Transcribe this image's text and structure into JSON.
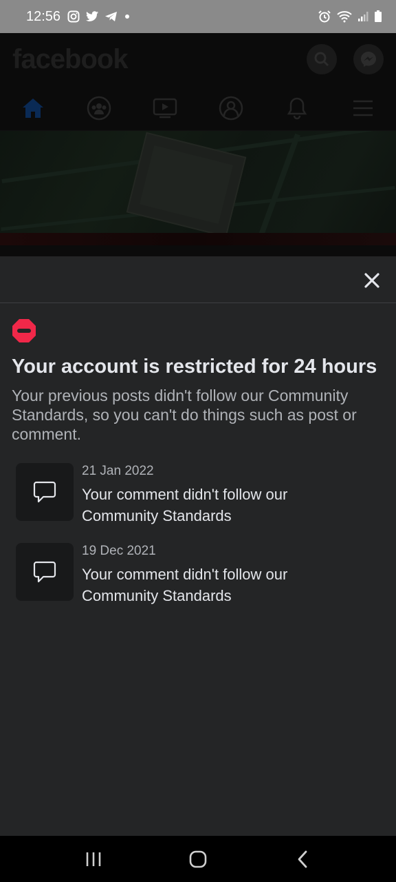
{
  "status_bar": {
    "time": "12:56",
    "left_icons": [
      "instagram-icon",
      "twitter-icon",
      "telegram-icon",
      "dot-icon"
    ],
    "right_icons": [
      "alarm-icon",
      "wifi-icon",
      "signal-icon",
      "battery-icon"
    ]
  },
  "background": {
    "logo": "facebook",
    "header_icons": [
      "search-icon",
      "messenger-icon"
    ],
    "nav_icons": [
      "home-icon",
      "groups-icon",
      "watch-icon",
      "profile-icon",
      "bell-icon",
      "menu-icon"
    ]
  },
  "sheet": {
    "close_icon": "close-icon",
    "warning_icon": "restricted-icon",
    "title": "Your account is restricted for 24 hours",
    "subtitle": "Your previous posts didn't follow our Community Standards, so you can't do things such as post or comment.",
    "violations": [
      {
        "date": "21 Jan 2022",
        "message": "Your comment didn't follow our Community Standards",
        "icon": "comment-icon"
      },
      {
        "date": "19 Dec 2021",
        "message": "Your comment didn't follow our Community Standards",
        "icon": "comment-icon"
      }
    ]
  },
  "nav_bar": {
    "buttons": [
      "recent-apps-icon",
      "home-circle-icon",
      "back-icon"
    ]
  },
  "colors": {
    "sheet_bg": "#242526",
    "restricted_red": "#f02849",
    "primary_text": "#e4e6eb",
    "secondary_text": "#b0b3b8"
  }
}
